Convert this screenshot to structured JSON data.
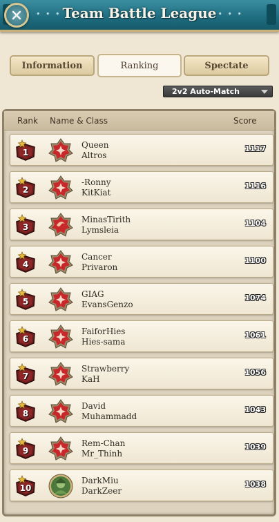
{
  "window": {
    "title": "Team Battle League",
    "close_icon": "close-x-icon",
    "ornament": "• • •"
  },
  "tabs": [
    {
      "label": "Information",
      "active": false
    },
    {
      "label": "Ranking",
      "active": true
    },
    {
      "label": "Spectate",
      "active": false
    }
  ],
  "mode_select": {
    "value": "2v2 Auto-Match"
  },
  "table": {
    "headers": {
      "rank": "Rank",
      "name_class": "Name & Class",
      "score": "Score"
    },
    "rows": [
      {
        "rank": "1",
        "name": "Queen",
        "class": "Altros",
        "score": "1117",
        "icon": "red-class-emblem-icon"
      },
      {
        "rank": "2",
        "name": "-Ronny",
        "class": "KitKiat",
        "score": "1116",
        "icon": "red-class-emblem-icon"
      },
      {
        "rank": "3",
        "name": "MinasTirith",
        "class": "Lymsleia",
        "score": "1104",
        "icon": "red-creature-class-icon"
      },
      {
        "rank": "4",
        "name": "Cancer",
        "class": "Privaron",
        "score": "1100",
        "icon": "red-class-emblem-icon"
      },
      {
        "rank": "5",
        "name": "GIAG",
        "class": "EvansGenzo",
        "score": "1074",
        "icon": "red-class-emblem-icon"
      },
      {
        "rank": "6",
        "name": "FaiforHies",
        "class": "Hies-sama",
        "score": "1061",
        "icon": "red-class-emblem-icon"
      },
      {
        "rank": "7",
        "name": "Strawberry",
        "class": "KaH",
        "score": "1056",
        "icon": "red-class-emblem-icon"
      },
      {
        "rank": "8",
        "name": "David",
        "class": "Muhammadd",
        "score": "1043",
        "icon": "red-class-emblem-icon"
      },
      {
        "rank": "9",
        "name": "Rem-Chan",
        "class": "Mr_Thinh",
        "score": "1039",
        "icon": "red-class-emblem-icon"
      },
      {
        "rank": "10",
        "name": "DarkMiu",
        "class": "DarkZeer",
        "score": "1038",
        "icon": "green-hero-portrait-icon"
      }
    ]
  },
  "colors": {
    "banner": "#1e6c7f",
    "rank_badge": "#7a1f1f",
    "star": "#e8b83a",
    "class_emblem": "#c8282a",
    "portrait": "#4c7a3c"
  }
}
